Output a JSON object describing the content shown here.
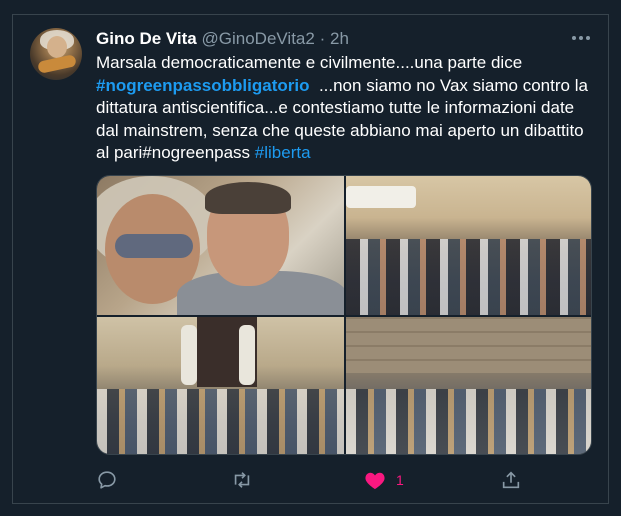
{
  "tweet": {
    "author_name": "Gino De Vita",
    "handle": "@GinoDeVita2",
    "separator": "·",
    "time": "2h",
    "text": {
      "part1": "Marsala democraticamente e civilmente....una parte dice",
      "hashtag1": "#nogreenpassobbligatorio",
      "part2": "...non siamo no Vax siamo contro la dittatura antiscientifica...e contestiamo tutte le informazioni date dal mainstrem, senza che queste abbiano mai aperto un dibattito al pari#nogreenpass",
      "hashtag2": "#liberta"
    },
    "media_count": 4
  },
  "actions": {
    "reply_icon": "reply-icon",
    "retweet_icon": "retweet-icon",
    "like_icon": "heart-filled-icon",
    "like_count": "1",
    "share_icon": "share-icon"
  },
  "colors": {
    "background": "#15202b",
    "accent": "#1d9bf0",
    "like": "#f91880",
    "muted": "#8899a6"
  }
}
